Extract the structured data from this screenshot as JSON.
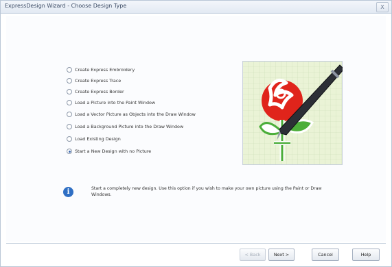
{
  "window": {
    "title": "ExpressDesign Wizard - Choose Design Type",
    "close_label": "X"
  },
  "options": [
    {
      "label": "Create Express Embroidery",
      "selected": false
    },
    {
      "label": "Create Express Trace",
      "selected": false
    },
    {
      "label": "Create Express Border",
      "selected": false
    },
    {
      "label": "Load a Picture into the Paint Window",
      "selected": false
    },
    {
      "label": "Load a Vector Picture as Objects into the Draw Window",
      "selected": false
    },
    {
      "label": "Load a Background Picture into the Draw Window",
      "selected": false
    },
    {
      "label": "Load Existing Design",
      "selected": false
    },
    {
      "label": "Start a New Design with no Picture",
      "selected": true
    }
  ],
  "info": {
    "icon": "info-icon",
    "text": "Start a completely new design. Use this option if you wish to make your own picture using the Paint or Draw Windows."
  },
  "buttons": {
    "back": "< Back",
    "next": "Next >",
    "cancel": "Cancel",
    "help": "Help"
  },
  "colors": {
    "info_blue": "#2f6fc4",
    "rose_red": "#e0241b",
    "leaf_green": "#4cae3a",
    "grid_bg": "#eaf3d6"
  }
}
